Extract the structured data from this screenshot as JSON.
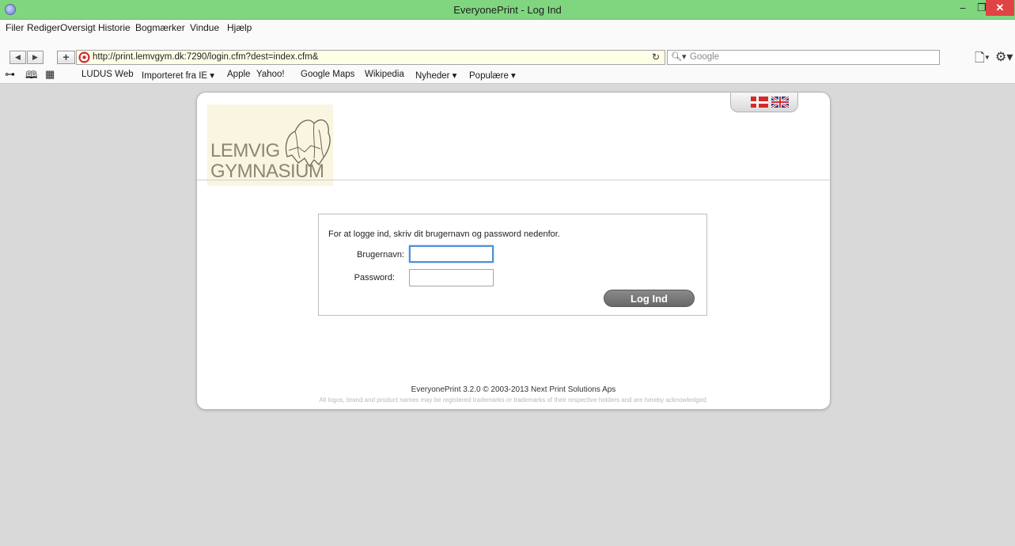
{
  "window": {
    "title": "EveryonePrint - Log Ind",
    "minimize": "–",
    "maximize": "❐",
    "close": "✕"
  },
  "menu": [
    "Filer",
    "Rediger",
    "Oversigt",
    "Historie",
    "Bogmærker",
    "Vindue",
    "Hjælp"
  ],
  "nav": {
    "back": "◀",
    "forward": "▶",
    "add": "+",
    "url": "http://print.lemvgym.dk:7290/login.cfm?dest=index.cfm&",
    "reload_icon": "reload-icon",
    "search_placeholder": "Google",
    "search_icon": "search-icon",
    "page_icon": "page-menu-icon",
    "settings_icon": "gear-icon"
  },
  "bookmarks": [
    "LUDUS Web",
    "Importeret fra IE ▾",
    "Apple",
    "Yahoo!",
    "Google Maps",
    "Wikipedia",
    "Nyheder ▾",
    "Populære ▾"
  ],
  "logo": {
    "line1": "LEMVIG",
    "line2": "GYMNASIUM"
  },
  "language": {
    "danish_icon": "danish-flag-icon",
    "english_icon": "uk-flag-icon"
  },
  "login": {
    "intro": "For at logge ind, skriv dit brugernavn og password nedenfor.",
    "username_label": "Brugernavn:",
    "username_value": "",
    "password_label": "Password:",
    "password_value": "",
    "submit": "Log Ind"
  },
  "footer": {
    "line1": "EveryonePrint 3.2.0 © 2003-2013 Next Print Solutions Aps",
    "line2": "All logos, brand and product names may be registered trademarks or trademarks of their respective holders and are hereby acknowledged."
  },
  "colors": {
    "titlebar": "#7fd67f",
    "page_bg": "#d8d9d8",
    "button": "#777777",
    "focus": "#4d8fd6"
  }
}
